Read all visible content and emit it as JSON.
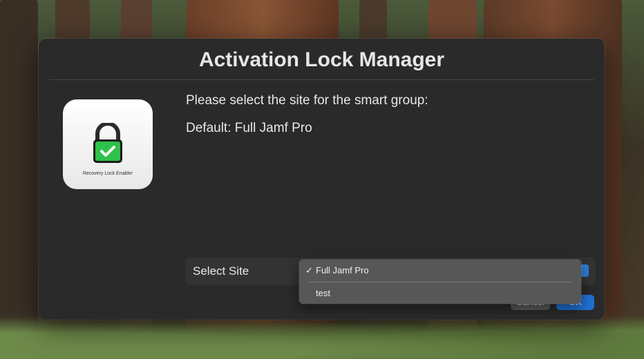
{
  "dialog": {
    "title": "Activation Lock Manager",
    "message_line1": "Please select the site for the smart group:",
    "message_line2": "Default: Full Jamf Pro",
    "app_icon_caption": "Recovery Lock Enabler",
    "select_label": "Select Site",
    "cancel_label": "Cancel",
    "ok_label": "OK"
  },
  "dropdown": {
    "items": [
      {
        "label": "Full Jamf Pro",
        "checked": true,
        "check_glyph": "✓"
      },
      {
        "label": "test",
        "checked": false,
        "check_glyph": ""
      }
    ]
  },
  "icons": {
    "app_icon": "padlock-check-icon"
  },
  "colors": {
    "accent": "#1f6fd1",
    "dialog_bg": "#2a2a2a",
    "lock_green": "#2fc24a"
  }
}
